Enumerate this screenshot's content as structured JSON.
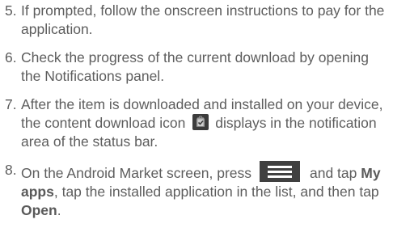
{
  "steps": [
    {
      "number": "5.",
      "text": "If prompted, follow the onscreen instructions to pay for the application."
    },
    {
      "number": "6.",
      "text": "Check the progress of the current download by opening the Notifications panel."
    },
    {
      "number": "7.",
      "text_before_icon": "After the item is downloaded and installed on your device, the content download icon",
      "icon": "content-download-icon",
      "text_after_icon": "displays in the notification area of the status bar."
    },
    {
      "number": "8.",
      "text_before_key": "On the Android Market screen, press",
      "key_icon": "menu-key-icon",
      "text_and_tap": "and tap",
      "my_apps": "My apps",
      "text_middle": ", tap the installed application in the list, and then tap",
      "open": "Open",
      "text_end": "."
    }
  ],
  "colors": {
    "text": "#5d5d5d",
    "icon_background": "#3c3c3c",
    "key_background": "#404040"
  }
}
